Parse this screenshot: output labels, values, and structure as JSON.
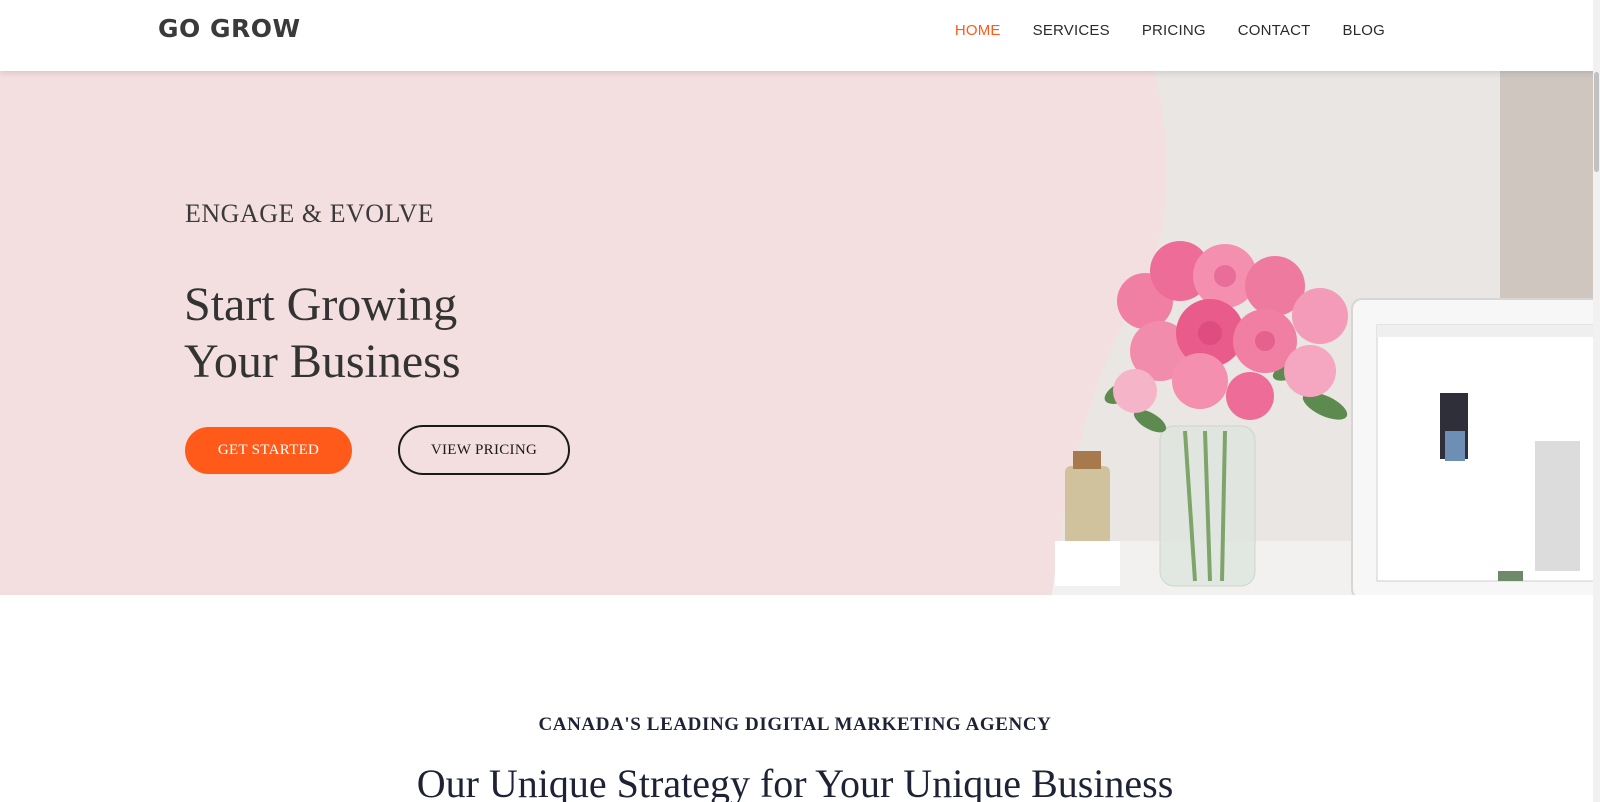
{
  "header": {
    "logo": "GO GROW",
    "nav": [
      {
        "label": "HOME",
        "active": true
      },
      {
        "label": "SERVICES",
        "active": false
      },
      {
        "label": "PRICING",
        "active": false
      },
      {
        "label": "CONTACT",
        "active": false
      },
      {
        "label": "BLOG",
        "active": false
      }
    ]
  },
  "hero": {
    "eyebrow": "ENGAGE & EVOLVE",
    "title_line1": "Start Growing",
    "title_line2": "Your Business",
    "primary_button": "GET STARTED",
    "secondary_button": "VIEW PRICING",
    "image_icon": "flowers-laptop-photo"
  },
  "intro": {
    "eyebrow": "CANADA'S LEADING DIGITAL MARKETING AGENCY",
    "title": "Our Unique Strategy for Your Unique Business"
  },
  "colors": {
    "accent": "#ff5a1a",
    "hero_bg": "#f4dfe0",
    "heading": "#1e2235"
  }
}
